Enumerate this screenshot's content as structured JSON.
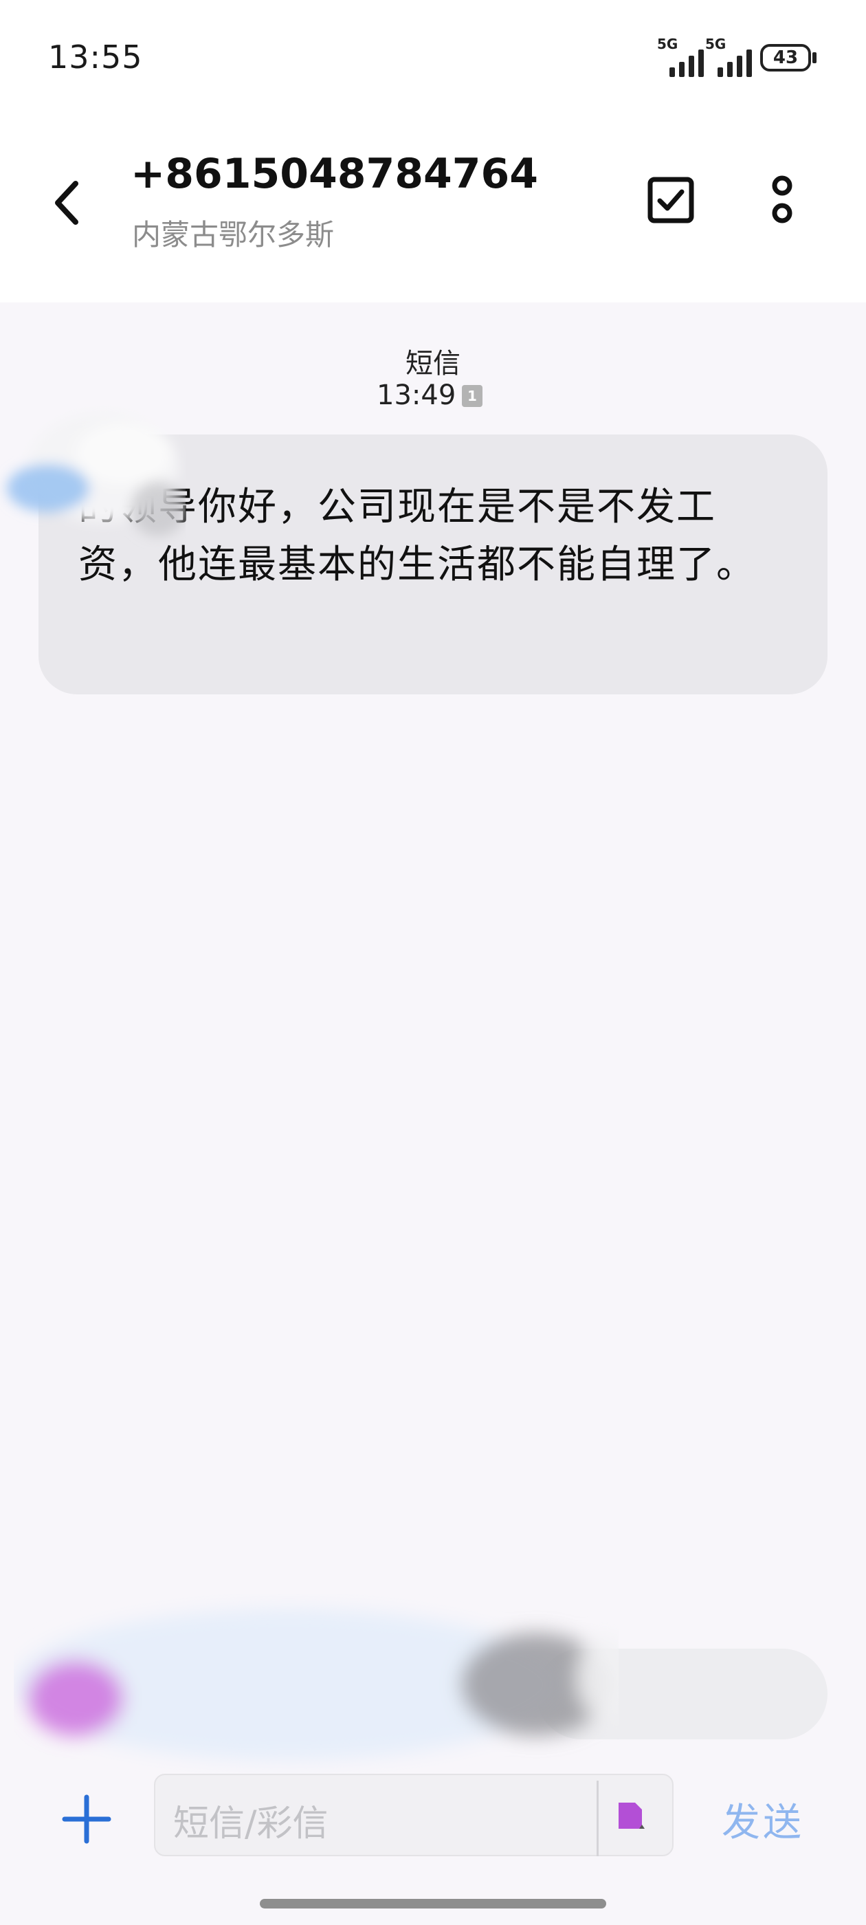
{
  "status_bar": {
    "time": "13:55",
    "sim1_network": "5G",
    "sim2_network": "5G",
    "battery": "43"
  },
  "header": {
    "contact_number": "+8615048784764",
    "contact_location": "内蒙古鄂尔多斯",
    "icons": [
      "back-icon",
      "select-icon",
      "more-icon"
    ]
  },
  "conversation": {
    "message_type": "短信",
    "timestamp": "13:49",
    "sim_label": "1",
    "message_text": "的领导你好，公司现在是不是不发工资，他连最基本的生活都不能自理了。"
  },
  "composer": {
    "placeholder": "短信/彩信",
    "send_label": "发送",
    "sim_selector_label": "1"
  },
  "colors": {
    "bubble": "#e9e8ec",
    "send": "#8fb6ef",
    "plus": "#2a6fd6",
    "sim_selector": "#b34fd6",
    "background": "#f8f6fa"
  }
}
